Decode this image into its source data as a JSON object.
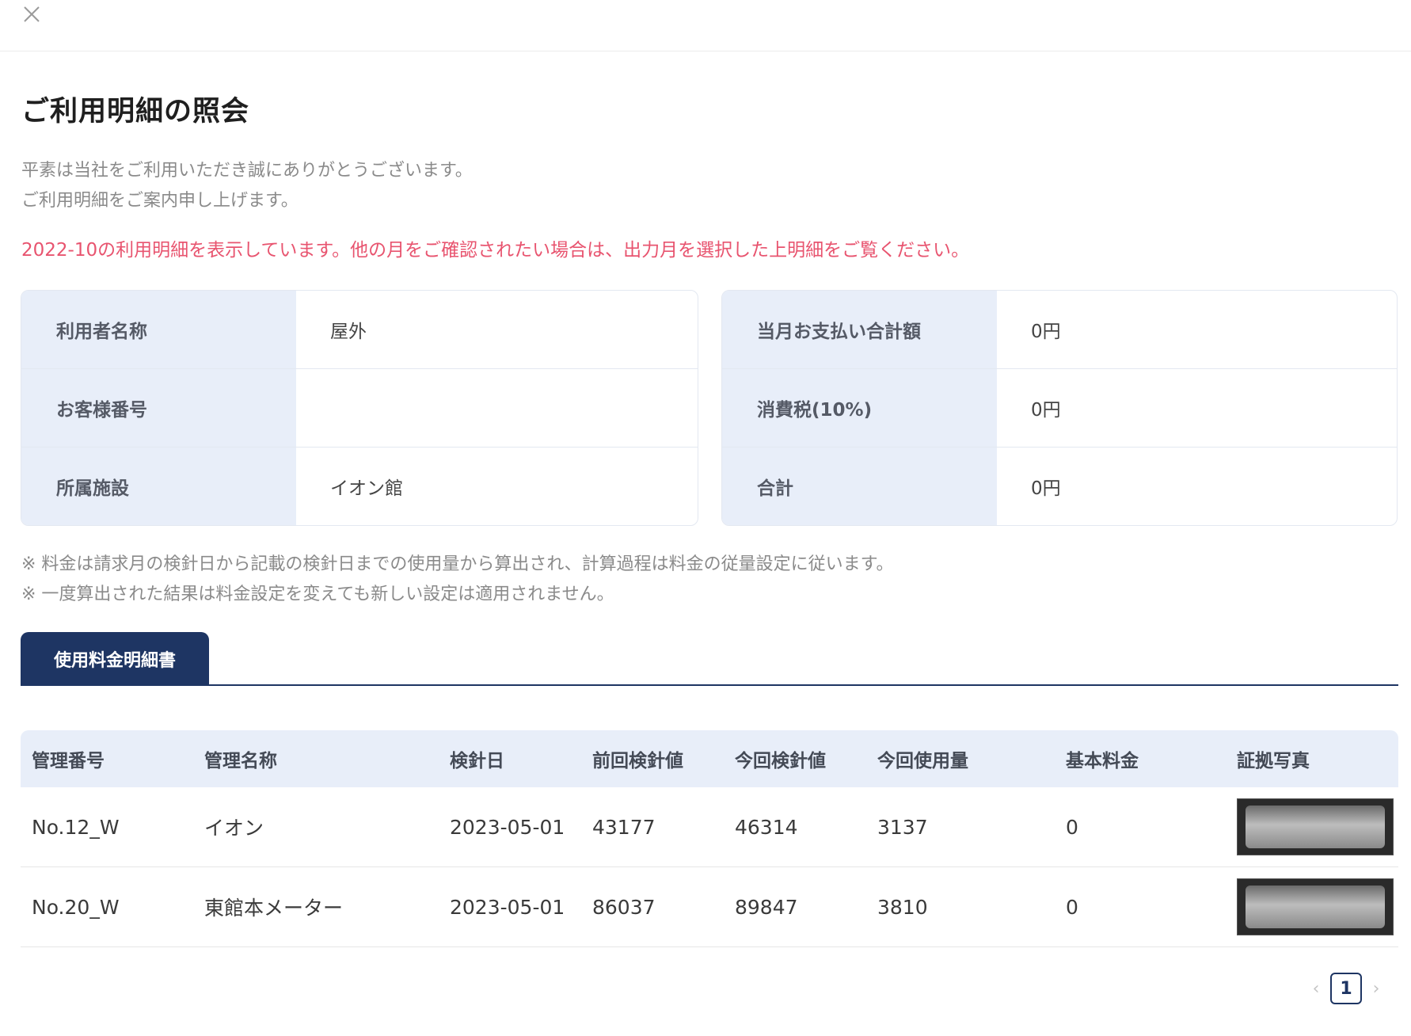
{
  "header": {
    "close_icon": "close-icon"
  },
  "page": {
    "title": "ご利用明細の照会",
    "intro_line1": "平素は当社をご利用いただき誠にありがとうございます。",
    "intro_line2": "ご利用明細をご案内申し上げます。",
    "notice": "2022-10の利用明細を表示しています。他の月をご確認されたい場合は、出力月を選択した上明細をご覧ください。"
  },
  "customer_info": [
    {
      "label": "利用者名称",
      "value": "屋外"
    },
    {
      "label": "お客様番号",
      "value": ""
    },
    {
      "label": "所属施設",
      "value": "イオン館"
    }
  ],
  "billing_info": [
    {
      "label": "当月お支払い合計額",
      "value": "0円"
    },
    {
      "label": "消費税(10%)",
      "value": "0円"
    },
    {
      "label": "合計",
      "value": "0円"
    }
  ],
  "notes": {
    "note1": "※ 料金は請求月の検針日から記載の検針日までの使用量から算出され、計算過程は料金の従量設定に従います。",
    "note2": "※ 一度算出された結果は料金設定を変えても新しい設定は適用されません。"
  },
  "tabs": {
    "active_label": "使用料金明細書"
  },
  "table": {
    "headers": [
      "管理番号",
      "管理名称",
      "検針日",
      "前回検針値",
      "今回検針値",
      "今回使用量",
      "基本料金",
      "証拠写真"
    ],
    "rows": [
      {
        "id": "No.12_W",
        "name": "イオン",
        "date": "2023-05-01",
        "prev": "43177",
        "curr": "46314",
        "usage": "3137",
        "base": "0"
      },
      {
        "id": "No.20_W",
        "name": "東館本メーター",
        "date": "2023-05-01",
        "prev": "86037",
        "curr": "89847",
        "usage": "3810",
        "base": "0"
      }
    ]
  },
  "pagination": {
    "current": "1",
    "prev_icon": "chevron-left-icon",
    "next_icon": "chevron-right-icon"
  },
  "colors": {
    "navy": "#1e3563",
    "label_bg": "#e8eef9",
    "notice": "#e8546f"
  }
}
